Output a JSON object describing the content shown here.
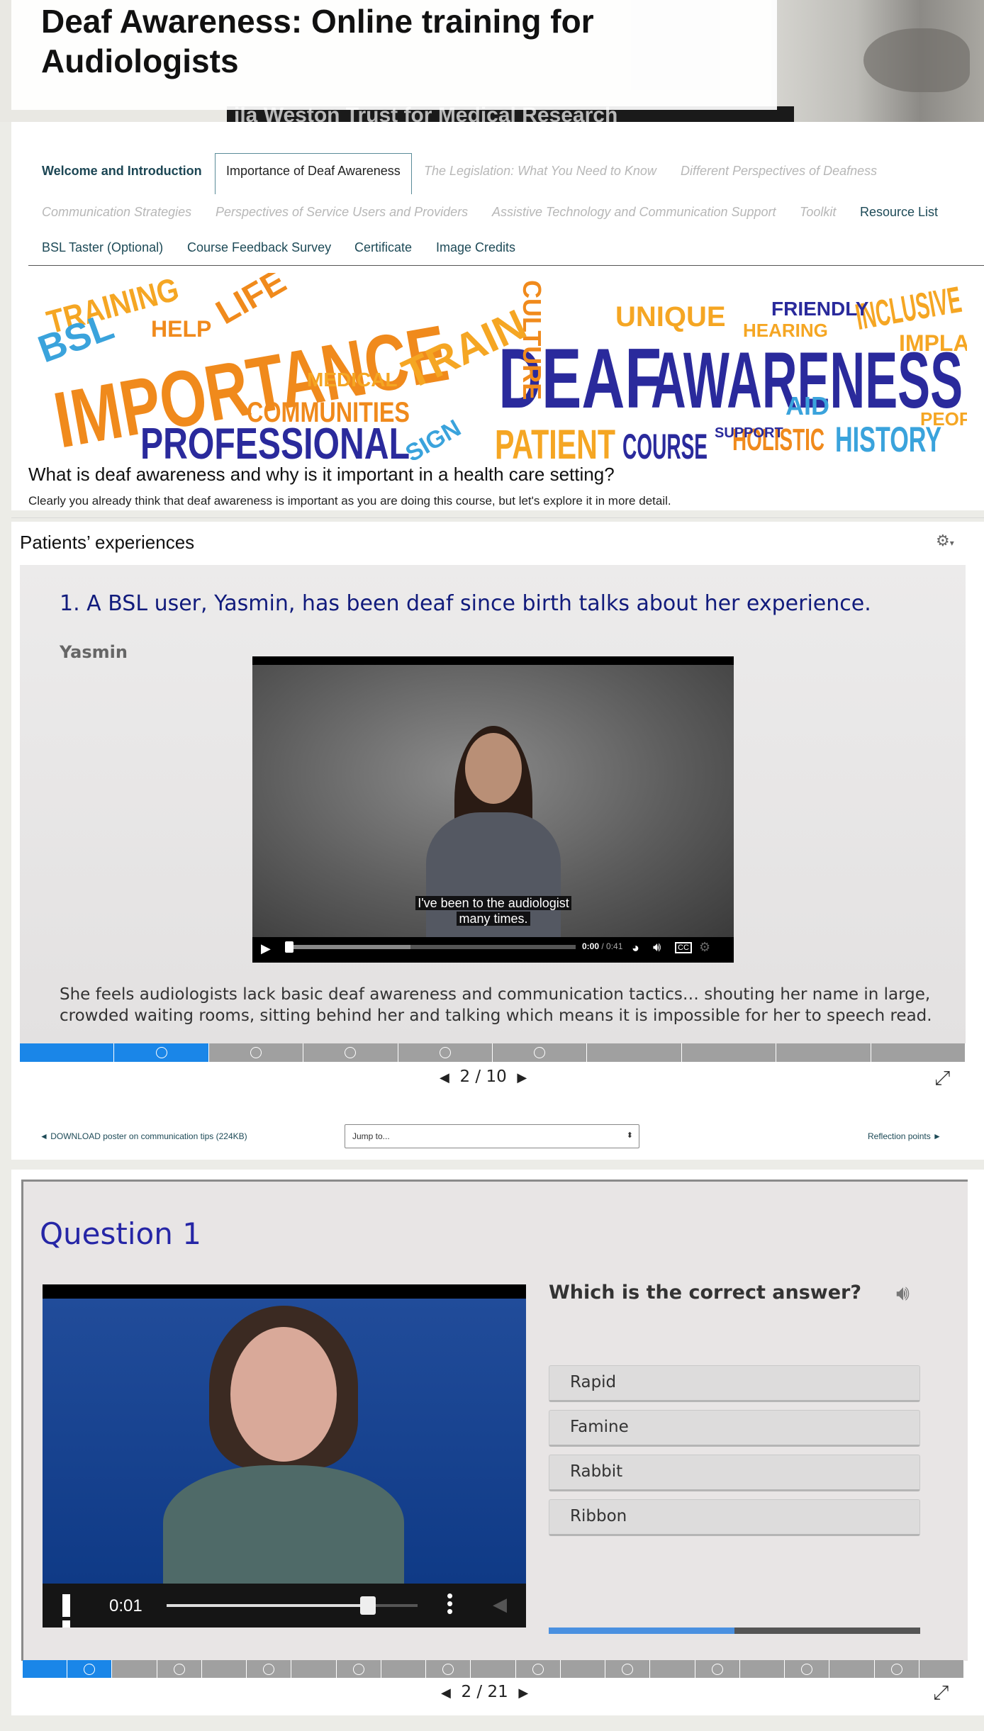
{
  "header": {
    "title": "Deaf Awareness: Online training for Audiologists",
    "background_banner_text": "ila Weston Trust for Medical Research"
  },
  "tabs": {
    "row1": [
      {
        "label": "Welcome and Introduction",
        "state": "visited"
      },
      {
        "label": "Importance of Deaf Awareness",
        "state": "current"
      },
      {
        "label": "The Legislation: What You Need to Know",
        "state": "disabled"
      },
      {
        "label": "Different Perspectives of Deafness",
        "state": "disabled"
      }
    ],
    "row2": [
      {
        "label": "Communication Strategies",
        "state": "disabled"
      },
      {
        "label": "Perspectives of Service Users and Providers",
        "state": "disabled"
      },
      {
        "label": "Assistive Technology and Communication Support",
        "state": "disabled"
      },
      {
        "label": "Toolkit",
        "state": "disabled"
      },
      {
        "label": "Resource List",
        "state": "link"
      }
    ],
    "row3": [
      {
        "label": "BSL Taster (Optional)",
        "state": "link"
      },
      {
        "label": "Course Feedback Survey",
        "state": "link"
      },
      {
        "label": "Certificate",
        "state": "link"
      },
      {
        "label": "Image Credits",
        "state": "link"
      }
    ]
  },
  "wordcloud": {
    "words": [
      "IMPORTANCE",
      "DEAF",
      "AWARENESS",
      "PROFESSIONAL",
      "TRAINING",
      "BSL",
      "COMMUNITIES",
      "PATIENT",
      "COURSE",
      "HOLISTIC",
      "HISTORY",
      "INCLUSIVE",
      "UNIQUE",
      "CULTURE",
      "MEDICAL",
      "HEARING",
      "IMPLANT",
      "PEOPLE",
      "TRAIN",
      "LIFE",
      "HELP",
      "SIGN",
      "AID",
      "SUPPORT",
      "FRIENDLY"
    ]
  },
  "section": {
    "heading": "What is deaf awareness and why is it important in a health care setting?",
    "intro": "Clearly you already think that deaf awareness is important as you are doing this course, but let's explore it in more detail."
  },
  "patients": {
    "title": "Patients’ experiences",
    "gear_icon": "gear-icon",
    "slide": {
      "question": "1.  A BSL user, Yasmin, has been deaf since birth talks about her experience.",
      "speaker": "Yasmin",
      "caption_line1": "I've been to the audiologist",
      "caption_line2": "many times.",
      "time_current": "0:00",
      "time_total": "/ 0:41",
      "description": "She feels audiologists lack basic deaf awareness and communication tactics… shouting her name in large, crowded waiting rooms, sitting behind her and talking which means it is impossible for her to speech read."
    },
    "pager": {
      "current": "2",
      "separator": "/",
      "total": "10"
    },
    "nav_segments": 10,
    "active_segment": 2
  },
  "footer_nav": {
    "download_link": "◄ DOWNLOAD poster on communication tips (224KB)",
    "jump_placeholder": "Jump to...",
    "next_link": "Reflection points ►"
  },
  "quiz": {
    "title": "Question 1",
    "question": "Which is the correct answer?",
    "video_time": "0:01",
    "video_progress": 0.8,
    "answers": [
      "Rapid",
      "Famine",
      "Rabbit",
      "Ribbon"
    ],
    "progress": 0.5,
    "pager": {
      "current": "2",
      "separator": "/",
      "total": "21"
    },
    "nav_segments": 21,
    "active_segment": 2
  },
  "colors": {
    "accent_blue": "#1a86e8",
    "tab_dark": "#1c4654",
    "question_blue": "#2626a6",
    "slide_question": "#111b7c"
  }
}
